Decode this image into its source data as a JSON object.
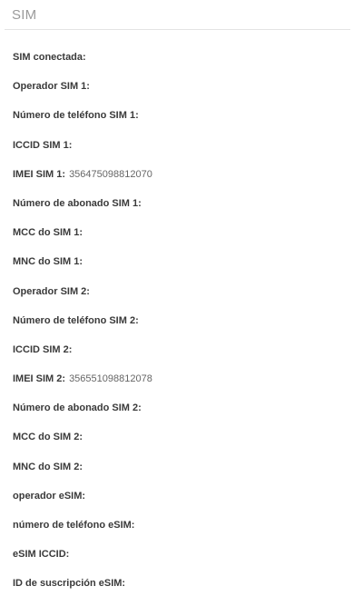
{
  "section": {
    "title": "SIM"
  },
  "rows": [
    {
      "label": "SIM conectada:",
      "value": ""
    },
    {
      "label": "Operador SIM 1:",
      "value": ""
    },
    {
      "label": "Número de teléfono SIM 1:",
      "value": ""
    },
    {
      "label": "ICCID SIM 1:",
      "value": ""
    },
    {
      "label": "IMEI SIM 1:",
      "value": "356475098812070"
    },
    {
      "label": "Número de abonado SIM 1:",
      "value": ""
    },
    {
      "label": "MCC do SIM 1:",
      "value": ""
    },
    {
      "label": "MNC do SIM 1:",
      "value": ""
    },
    {
      "label": "Operador SIM 2:",
      "value": ""
    },
    {
      "label": "Número de teléfono SIM 2:",
      "value": ""
    },
    {
      "label": "ICCID SIM 2:",
      "value": ""
    },
    {
      "label": "IMEI SIM 2:",
      "value": "356551098812078"
    },
    {
      "label": "Número de abonado SIM 2:",
      "value": ""
    },
    {
      "label": "MCC do SIM 2:",
      "value": ""
    },
    {
      "label": "MNC do SIM 2:",
      "value": ""
    },
    {
      "label": "operador eSIM:",
      "value": ""
    },
    {
      "label": "número de teléfono eSIM:",
      "value": ""
    },
    {
      "label": "eSIM ICCID:",
      "value": ""
    },
    {
      "label": "ID de suscripción eSIM:",
      "value": ""
    }
  ]
}
